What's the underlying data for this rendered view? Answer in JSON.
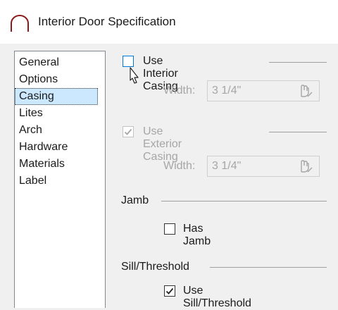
{
  "window": {
    "title": "Interior Door Specification",
    "title_icon": "door-arch-icon"
  },
  "nav": {
    "items": [
      {
        "label": "General",
        "selected": false
      },
      {
        "label": "Options",
        "selected": false
      },
      {
        "label": "Casing",
        "selected": true
      },
      {
        "label": "Lites",
        "selected": false
      },
      {
        "label": "Arch",
        "selected": false
      },
      {
        "label": "Hardware",
        "selected": false
      },
      {
        "label": "Materials",
        "selected": false
      },
      {
        "label": "Label",
        "selected": false
      }
    ]
  },
  "casing": {
    "interior": {
      "label": "Use Interior Casing",
      "checked": false,
      "width_label": "Width:",
      "width_value": "3 1/4\""
    },
    "exterior": {
      "label": "Use Exterior Casing",
      "checked": true,
      "disabled": true,
      "width_label": "Width:",
      "width_value": "3 1/4\""
    }
  },
  "jamb": {
    "section_label": "Jamb",
    "has_jamb_label": "Has Jamb",
    "checked": false
  },
  "sill": {
    "section_label": "Sill/Threshold",
    "use_label": "Use Sill/Threshold",
    "checked": true
  },
  "colors": {
    "selection": "#cce8ff",
    "focus": "#0078d7",
    "disabled": "#a6a6a6"
  }
}
